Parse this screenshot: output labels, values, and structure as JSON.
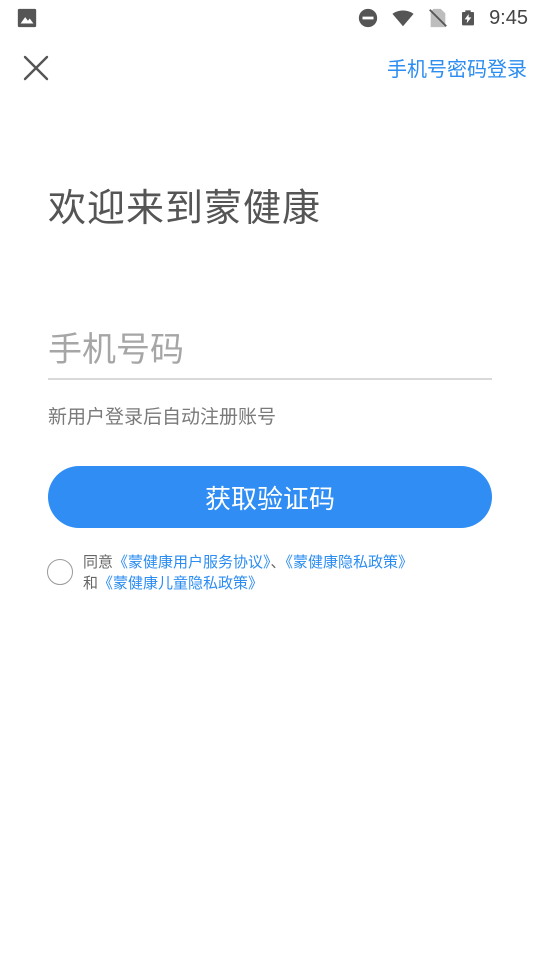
{
  "status_bar": {
    "time": "9:45",
    "icons": [
      "gallery-icon",
      "do-not-disturb-icon",
      "wifi-icon",
      "no-sim-icon",
      "battery-charging-icon"
    ]
  },
  "header": {
    "close_icon": "close-icon",
    "password_login_label": "手机号密码登录"
  },
  "main": {
    "welcome_title": "欢迎来到蒙健康",
    "phone_input": {
      "value": "",
      "placeholder": "手机号码"
    },
    "hint": "新用户登录后自动注册账号",
    "get_code_label": "获取验证码"
  },
  "agreement": {
    "checked": false,
    "prefix": "同意",
    "link1": "《蒙健康用户服务协议》",
    "separator": "、",
    "link2": "《蒙健康隐私政策》",
    "and": "和",
    "link3": "《蒙健康儿童隐私政策》"
  },
  "colors": {
    "accent": "#2f8df3",
    "link": "#2b8cf1"
  }
}
